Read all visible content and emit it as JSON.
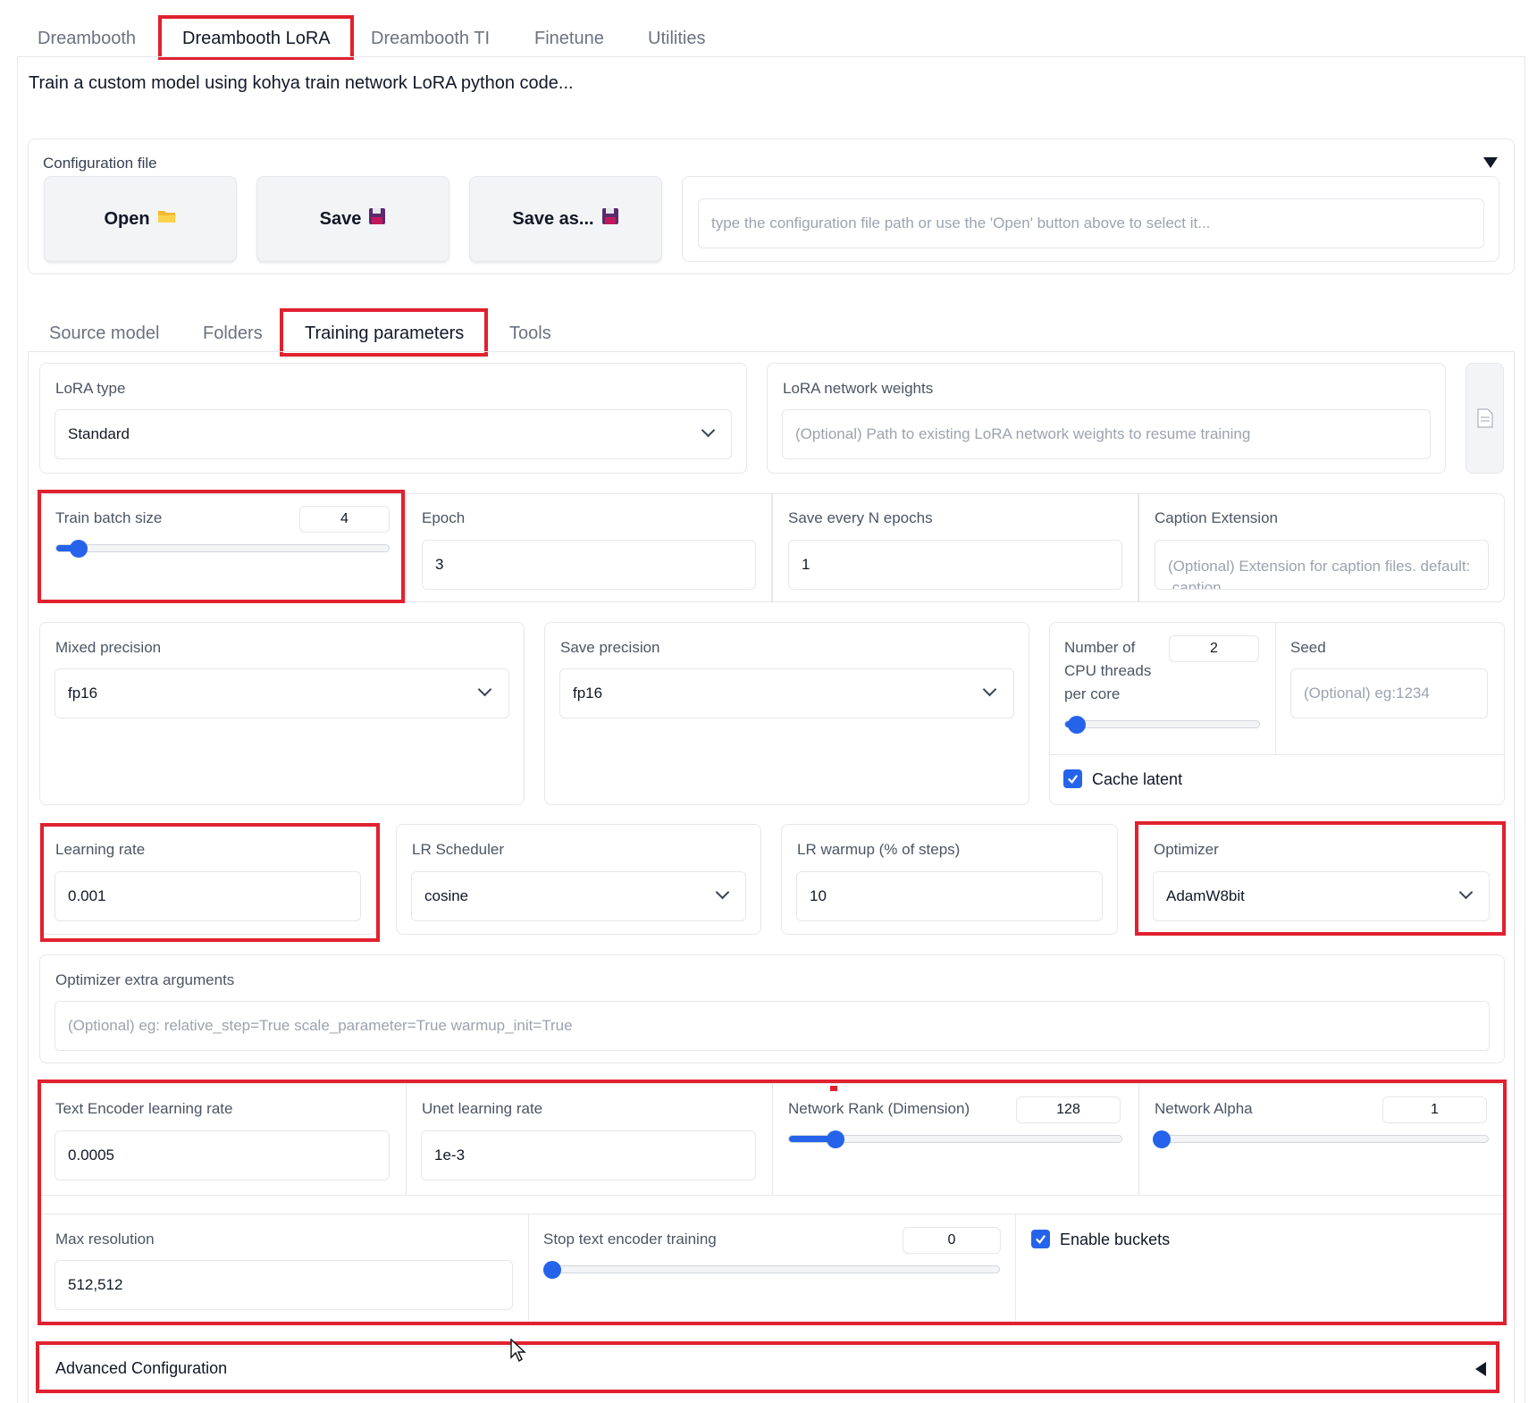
{
  "top_tabs": [
    "Dreambooth",
    "Dreambooth LoRA",
    "Dreambooth TI",
    "Finetune",
    "Utilities"
  ],
  "description": "Train a custom model using kohya train network LoRA python code...",
  "config": {
    "title": "Configuration file",
    "open_label": "Open",
    "save_label": "Save",
    "save_as_label": "Save as...",
    "path_placeholder": "type the configuration file path or use the 'Open' button above to select it..."
  },
  "sub_tabs": [
    "Source model",
    "Folders",
    "Training parameters",
    "Tools"
  ],
  "lora_type": {
    "label": "LoRA type",
    "value": "Standard"
  },
  "network_weights": {
    "label": "LoRA network weights",
    "placeholder": "(Optional) Path to existing LoRA network weights to resume training"
  },
  "train_batch_size": {
    "label": "Train batch size",
    "value": "4",
    "fraction": 0.08
  },
  "epoch": {
    "label": "Epoch",
    "value": "3"
  },
  "save_every": {
    "label": "Save every N epochs",
    "value": "1"
  },
  "caption_ext": {
    "label": "Caption Extension",
    "placeholder": "(Optional) Extension for caption files. default: .caption"
  },
  "mixed_precision": {
    "label": "Mixed precision",
    "value": "fp16"
  },
  "save_precision": {
    "label": "Save precision",
    "value": "fp16"
  },
  "cpu_threads": {
    "label_lines": [
      "Number of",
      "CPU threads",
      "per core"
    ],
    "value": "2",
    "fraction": 0.07
  },
  "seed": {
    "label": "Seed",
    "placeholder": "(Optional) eg:1234"
  },
  "cache_latent": {
    "label": "Cache latent",
    "checked": true
  },
  "learning_rate": {
    "label": "Learning rate",
    "value": "0.001"
  },
  "lr_scheduler": {
    "label": "LR Scheduler",
    "value": "cosine"
  },
  "lr_warmup": {
    "label": "LR warmup (% of steps)",
    "value": "10"
  },
  "optimizer": {
    "label": "Optimizer",
    "value": "AdamW8bit"
  },
  "optimizer_args": {
    "label": "Optimizer extra arguments",
    "placeholder": "(Optional) eg: relative_step=True scale_parameter=True warmup_init=True"
  },
  "text_encoder_lr": {
    "label": "Text Encoder learning rate",
    "value": "0.0005"
  },
  "unet_lr": {
    "label": "Unet learning rate",
    "value": "1e-3"
  },
  "network_rank": {
    "label": "Network Rank (Dimension)",
    "value": "128",
    "fraction": 0.14
  },
  "network_alpha": {
    "label": "Network Alpha",
    "value": "1",
    "fraction": 0.01
  },
  "max_resolution": {
    "label": "Max resolution",
    "value": "512,512"
  },
  "stop_text_encoder": {
    "label": "Stop text encoder training",
    "value": "0",
    "fraction": 0.0
  },
  "enable_buckets": {
    "label": "Enable buckets",
    "checked": true
  },
  "advanced": {
    "label": "Advanced Configuration"
  },
  "colors": {
    "accent": "#2563eb",
    "highlight": "#e0212f"
  }
}
